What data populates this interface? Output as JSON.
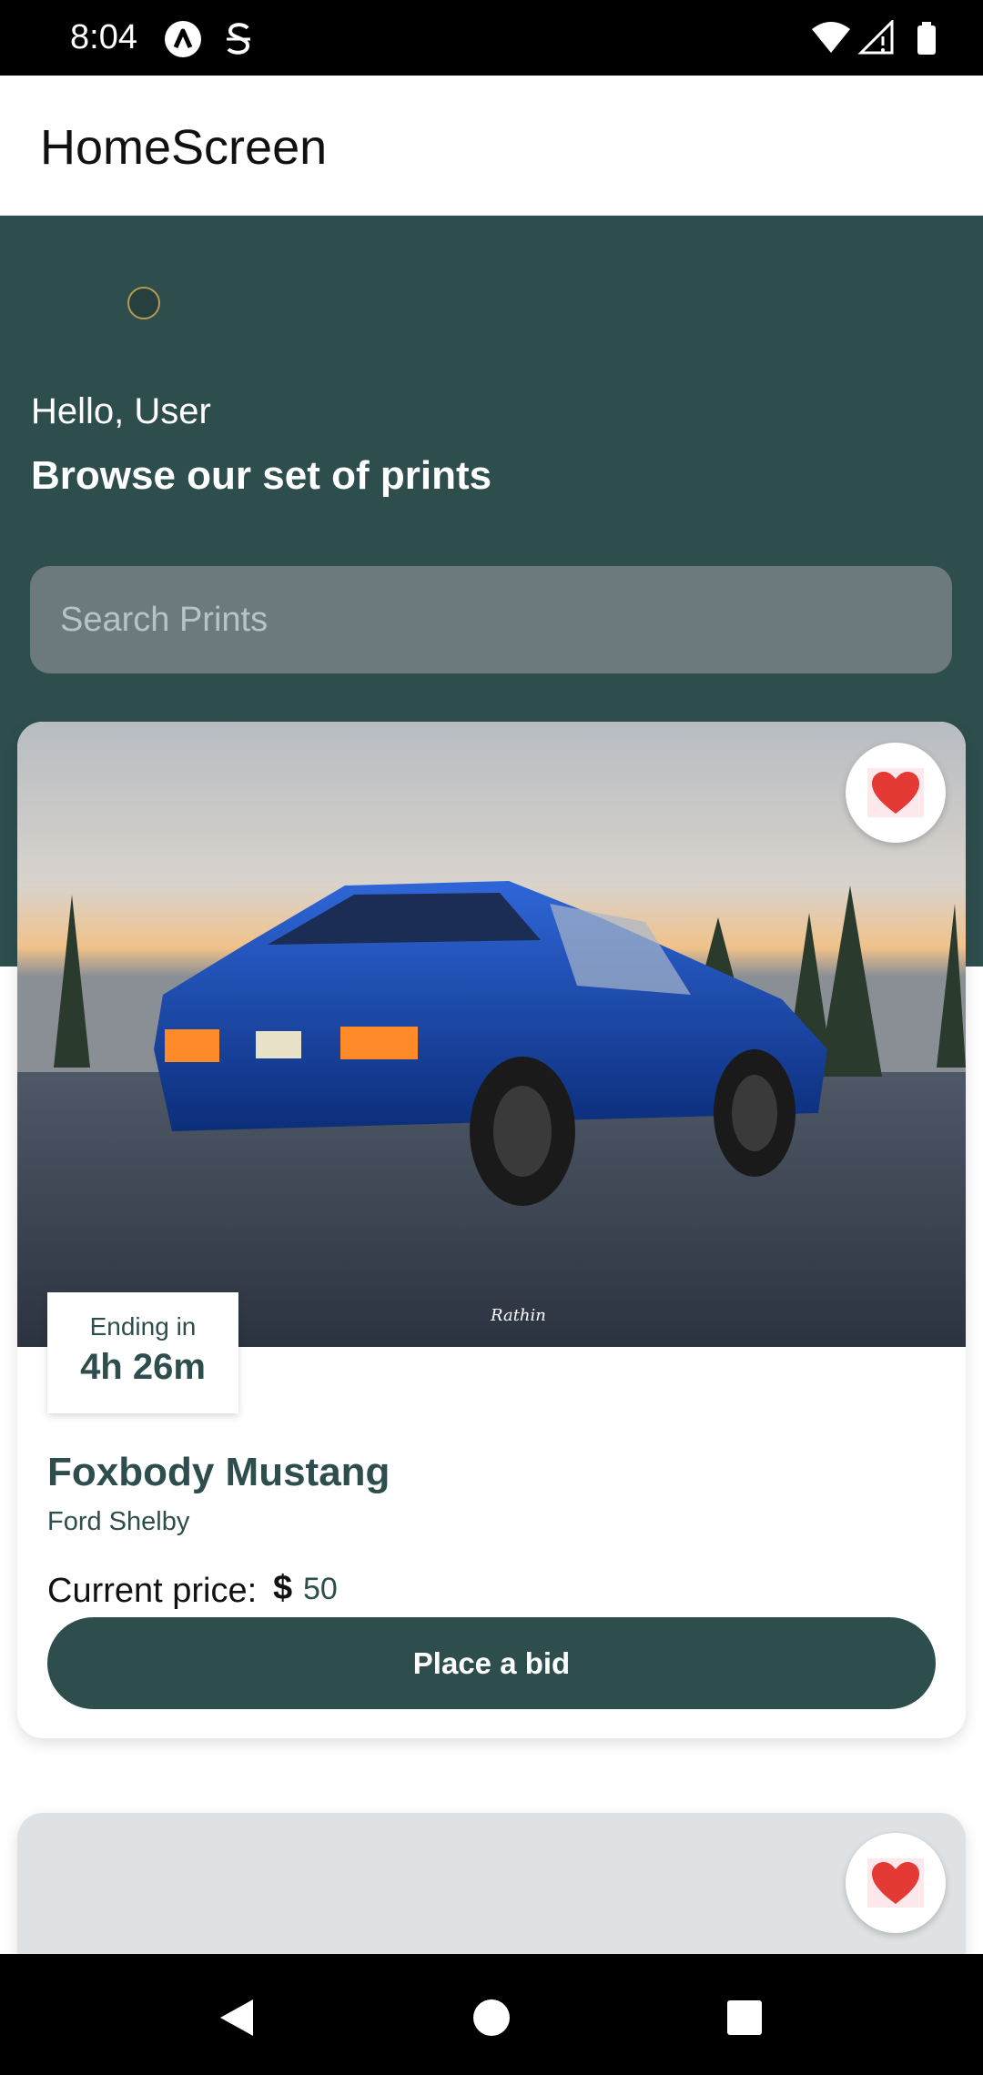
{
  "status_bar": {
    "time": "8:04",
    "icons": [
      "a-logo-icon",
      "s-logo-icon",
      "wifi-icon",
      "signal-icon",
      "battery-icon"
    ]
  },
  "app_bar": {
    "title": "HomeScreen"
  },
  "hero": {
    "greeting": "Hello, User",
    "headline": "Browse our set of prints",
    "search": {
      "placeholder": "Search Prints",
      "value": ""
    }
  },
  "cards": [
    {
      "ending_label": "Ending in",
      "ending_time": "4h 26m",
      "title": "Foxbody Mustang",
      "subtitle": "Ford Shelby",
      "price_label": "Current price:",
      "price_currency": "$",
      "price_value": "50",
      "bid_label": "Place a bid",
      "photo_signature": "Rathin"
    }
  ],
  "colors": {
    "primary": "#2e4e4e",
    "search_bg": "#6c7a7d",
    "heart": "#e53935"
  },
  "nav_bar": {
    "buttons": [
      "back-icon",
      "home-icon",
      "recents-icon"
    ]
  }
}
